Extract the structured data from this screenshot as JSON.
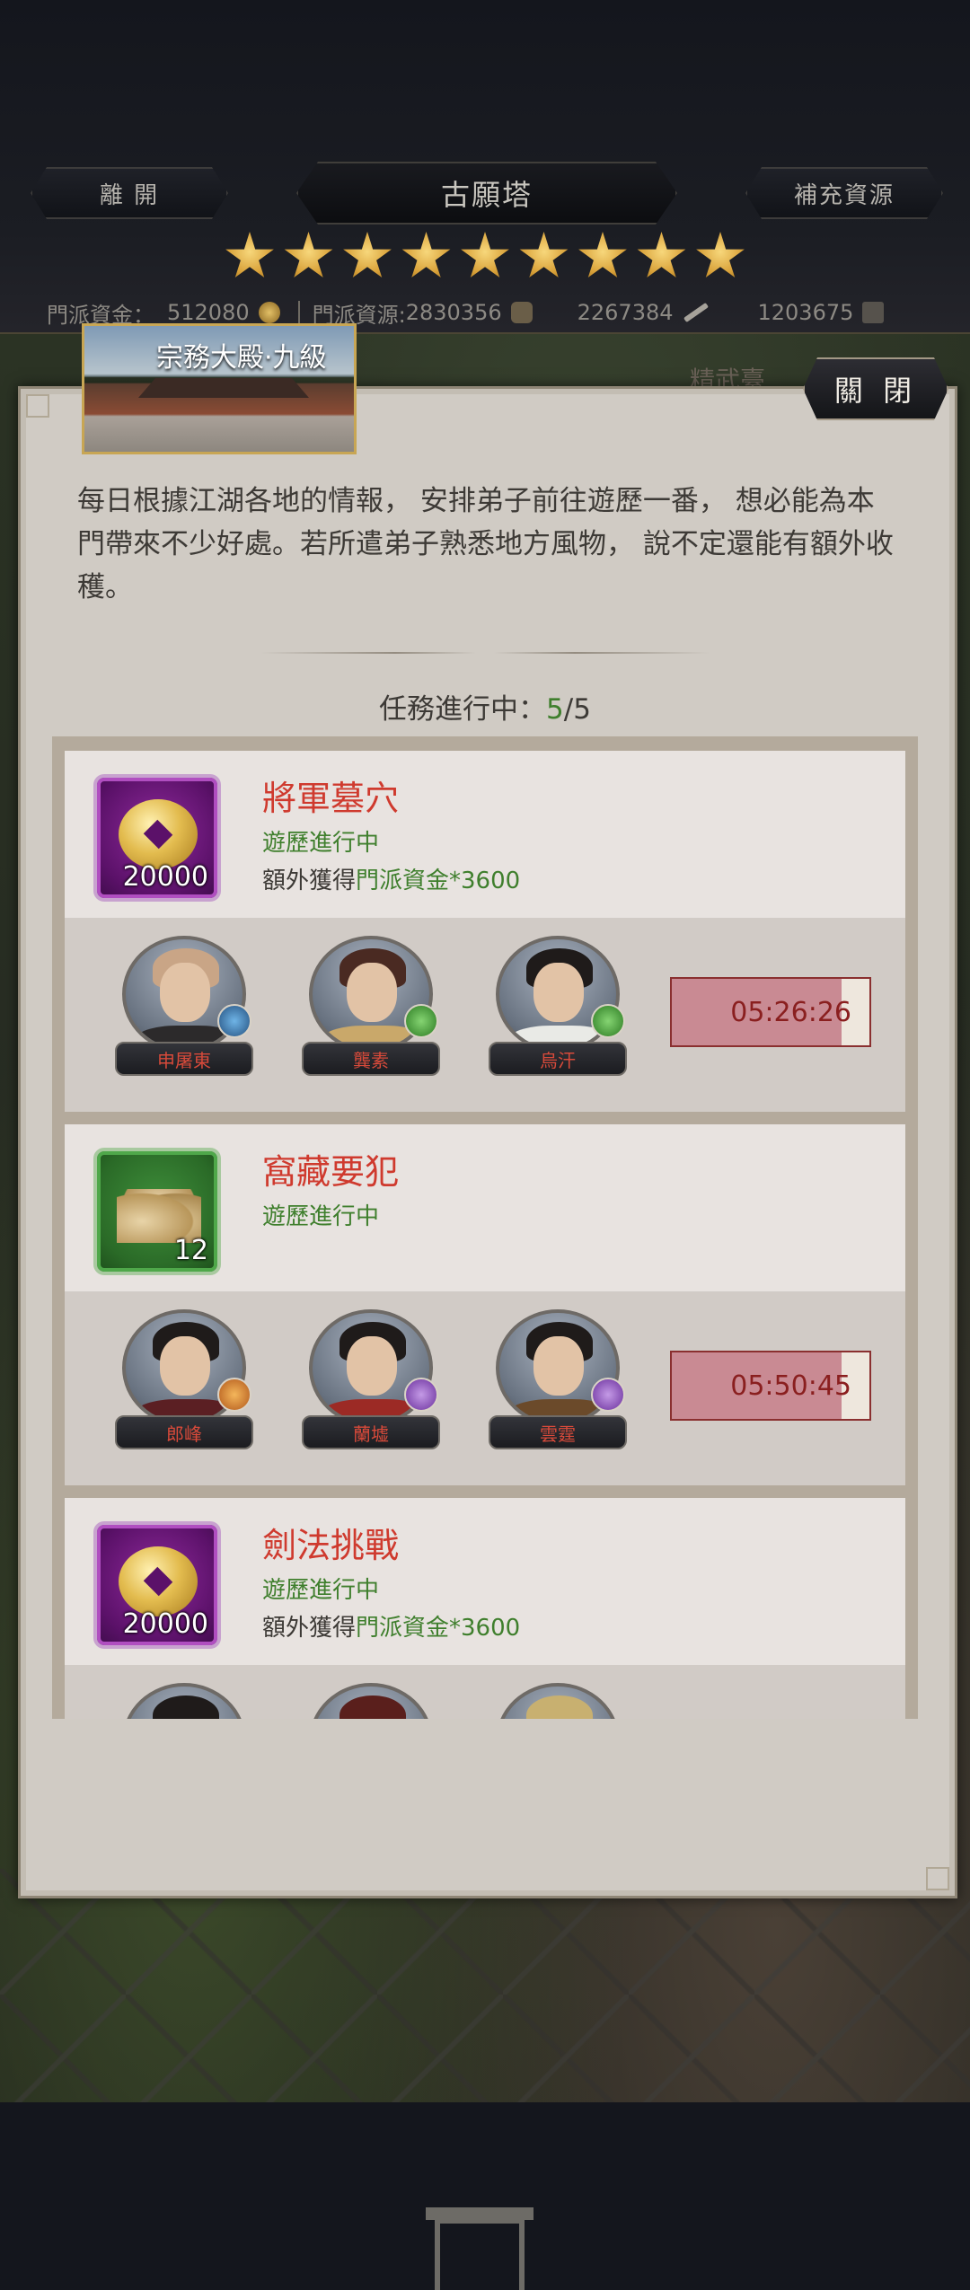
{
  "header": {
    "leave_label": "離  開",
    "title": "古願塔",
    "supply_label": "補充資源",
    "star_count": 9,
    "resources": {
      "funds_label": "門派資金：",
      "funds_value": "512080",
      "materials_label": "門派資源:",
      "materials_value": "2830356",
      "res2_value": "2267384",
      "res3_value": "1203675"
    }
  },
  "panel": {
    "building_label": "宗務大殿·九級",
    "behind_tab": "精武臺",
    "close_label": "關 閉",
    "description": "每日根據江湖各地的情報，  安排弟子前往遊歷一番，  想必能為本門帶來不少好處。若所遣弟子熟悉地方風物，  說不定還能有額外收穫。",
    "progress_label": "任務進行中：",
    "progress_current": "5",
    "progress_total": "/5"
  },
  "tasks": [
    {
      "name": "將軍墓穴",
      "status": "遊歷進行中",
      "extra_prefix": "額外獲得",
      "extra_highlight": "門派資金*3600",
      "reward_qty": "20000",
      "reward_icon": "gold-coin-icon",
      "timer": "05:26:26",
      "timer_remaining_fraction": 0.86,
      "disciples": [
        {
          "name": "申屠東",
          "badge": "blue"
        },
        {
          "name": "龔素",
          "badge": "green"
        },
        {
          "name": "烏汗",
          "badge": "green"
        }
      ]
    },
    {
      "name": "窩藏要犯",
      "status": "遊歷進行中",
      "reward_qty": "12",
      "reward_icon": "grain-sacks-icon",
      "timer": "05:50:45",
      "timer_remaining_fraction": 0.86,
      "disciples": [
        {
          "name": "郎峰",
          "badge": "orange"
        },
        {
          "name": "蘭墟",
          "badge": "purple"
        },
        {
          "name": "雲霆",
          "badge": "purple"
        }
      ]
    },
    {
      "name": "劍法挑戰",
      "status": "遊歷進行中",
      "extra_prefix": "額外獲得",
      "extra_highlight": "門派資金*3600",
      "reward_qty": "20000",
      "reward_icon": "gold-coin-icon"
    }
  ],
  "colors": {
    "task_name": "#cf3a2e",
    "status_green": "#3f7f2d",
    "star_gold": "#d9a23a"
  }
}
